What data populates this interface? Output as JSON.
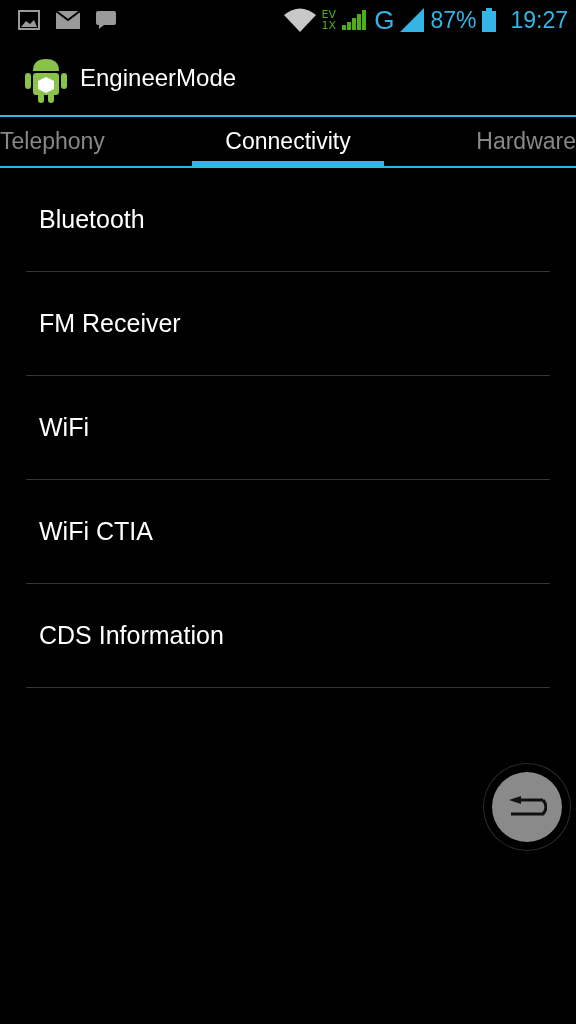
{
  "status_bar": {
    "network_type": "EV",
    "network_sub": "1X",
    "data_type": "G",
    "battery": "87%",
    "time": "19:27"
  },
  "app_bar": {
    "title": "EngineerMode"
  },
  "tabs": [
    {
      "label": "Telephony",
      "selected": false
    },
    {
      "label": "Connectivity",
      "selected": true
    },
    {
      "label": "Hardware",
      "selected": false
    }
  ],
  "items": [
    {
      "label": "Bluetooth"
    },
    {
      "label": "FM Receiver"
    },
    {
      "label": "WiFi"
    },
    {
      "label": "WiFi CTIA"
    },
    {
      "label": "CDS Information"
    }
  ]
}
